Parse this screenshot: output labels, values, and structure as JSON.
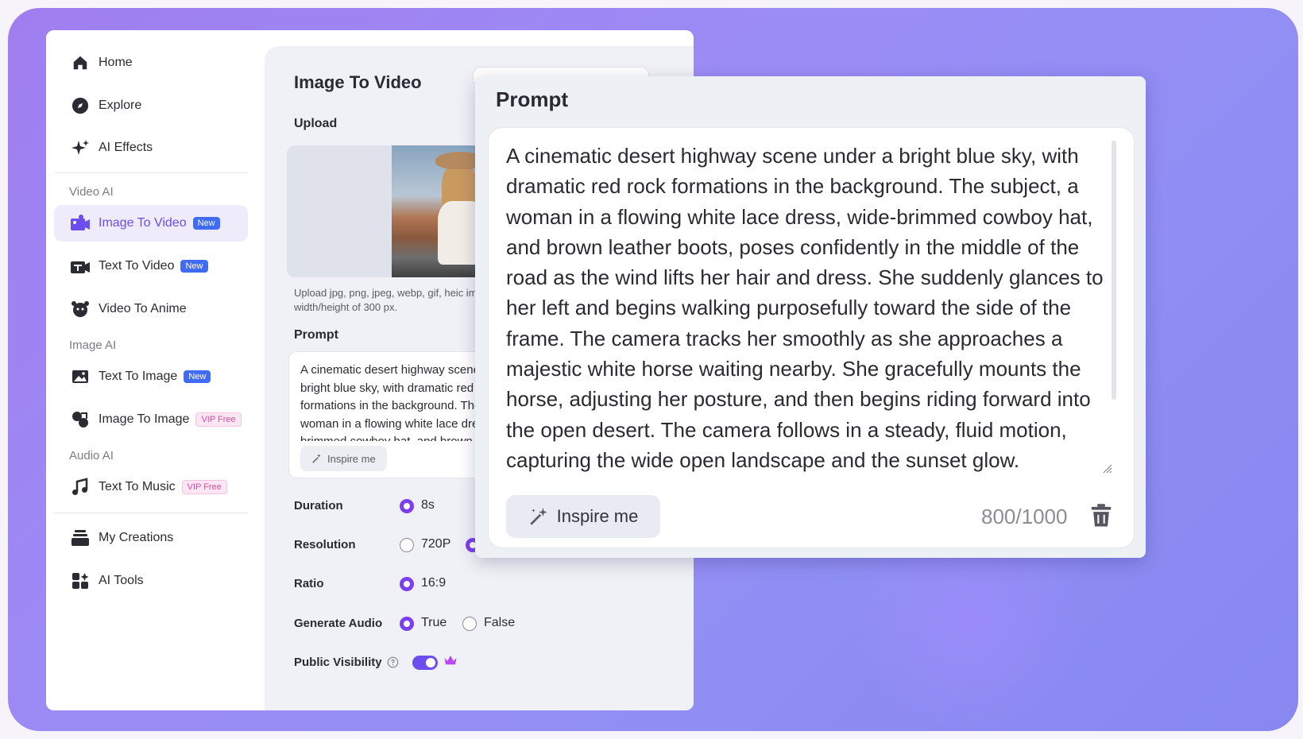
{
  "sidebar": {
    "items": [
      {
        "label": "Home",
        "icon": "home-icon"
      },
      {
        "label": "Explore",
        "icon": "compass-icon"
      },
      {
        "label": "AI Effects",
        "icon": "sparkle-icon"
      },
      {
        "label": "Image To Video",
        "icon": "image-video-icon",
        "badge": "New",
        "active": true
      },
      {
        "label": "Text To Video",
        "icon": "text-video-icon",
        "badge": "New"
      },
      {
        "label": "Video To Anime",
        "icon": "anime-icon"
      },
      {
        "label": "Text To Image",
        "icon": "text-image-icon",
        "badge": "New"
      },
      {
        "label": "Image To Image",
        "icon": "image-image-icon",
        "badge": "VIP Free"
      },
      {
        "label": "Text To Music",
        "icon": "music-icon",
        "badge": "VIP Free"
      },
      {
        "label": "My Creations",
        "icon": "stack-icon"
      },
      {
        "label": "AI Tools",
        "icon": "tools-icon"
      }
    ],
    "sections": {
      "video_ai": "Video AI",
      "image_ai": "Image AI",
      "audio_ai": "Audio AI"
    }
  },
  "main": {
    "title": "Image To Video",
    "upload_label": "Upload",
    "upload_hint": "Upload jpg, png, jpeg, webp, gif, heic ima width/height of 300 px.",
    "prompt_label": "Prompt",
    "prompt_preview": "A cinematic desert highway scene under a bright blue sky, with dramatic red rock formations in the background. The subject, a woman in a flowing white lace dress, wide-brimmed cowboy hat, and brown leather boots, poses confidently in the middle of the road as the wind lifts her hair and dress.",
    "inspire_label": "Inspire me",
    "options": {
      "duration": {
        "label": "Duration",
        "value": "8s"
      },
      "resolution": {
        "label": "Resolution",
        "value_a": "720P"
      },
      "ratio": {
        "label": "Ratio",
        "value": "16:9"
      },
      "generate_audio": {
        "label": "Generate Audio",
        "true_label": "True",
        "false_label": "False"
      },
      "public_visibility": {
        "label": "Public Visibility"
      }
    }
  },
  "modal": {
    "title": "Prompt",
    "text": "A cinematic desert highway scene under a bright blue sky, with dramatic red rock formations in the background. The subject, a woman in a flowing white lace dress, wide-brimmed cowboy hat, and brown leather boots, poses confidently in the middle of the road as the wind lifts her hair and dress. She suddenly glances to her left and begins walking purposefully toward the side of the frame. The camera tracks her smoothly as she approaches a majestic white horse waiting nearby. She gracefully mounts the horse, adjusting her posture, and then begins riding forward into the open desert. The camera follows in a steady, fluid motion, capturing the wide open landscape and the sunset glow.",
    "inspire_label": "Inspire me",
    "counter": "800/1000"
  },
  "colors": {
    "accent": "#6b4df0",
    "radio": "#7b3ff0",
    "badge_new": "#3f6bf5",
    "badge_vip": "#d94aa3"
  }
}
